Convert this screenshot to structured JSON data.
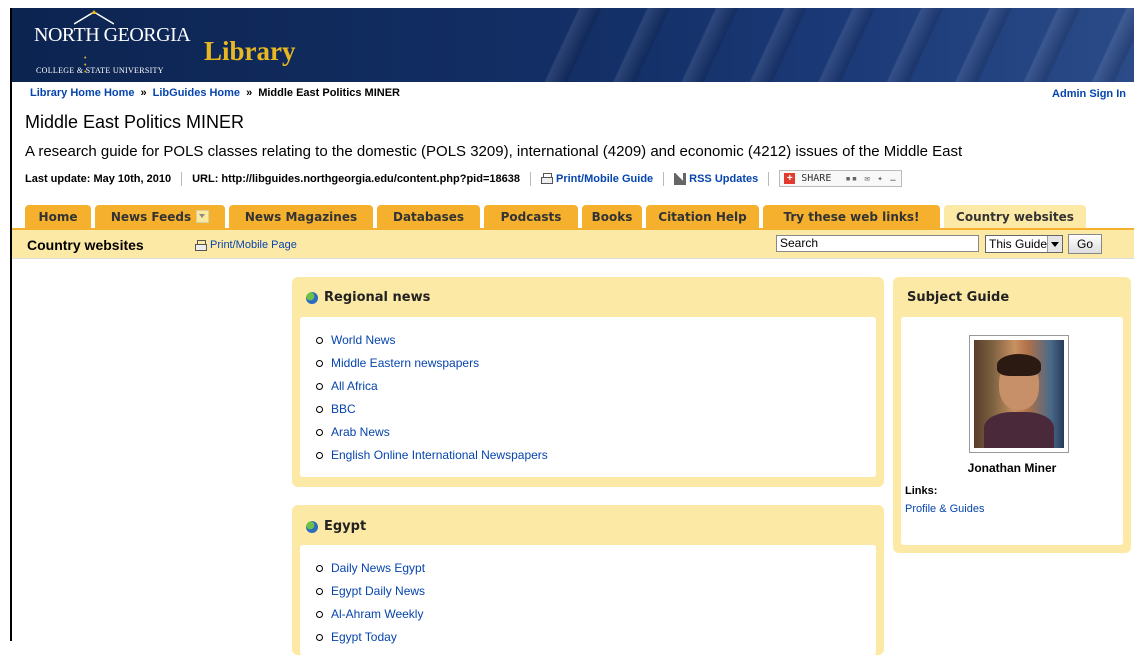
{
  "header": {
    "logo_title": "NORTH GEORGIA",
    "logo_subtitle": "COLLEGE & STATE UNIVERSITY",
    "library_label": "Library"
  },
  "breadcrumb": {
    "items": [
      "Library Home Home",
      "LibGuides Home"
    ],
    "separator": "»",
    "current": "Middle East Politics MINER"
  },
  "admin_link": "Admin Sign In",
  "page": {
    "title": "Middle East Politics MINER",
    "description": "A research guide for POLS classes relating to the domestic (POLS 3209), international (4209) and economic (4212) issues of the Middle East",
    "last_update": "Last update: May 10th, 2010",
    "url": "URL: http://libguides.northgeorgia.edu/content.php?pid=18638",
    "print_guide": "Print/Mobile Guide",
    "rss": "RSS Updates",
    "share": "SHARE"
  },
  "tabs": [
    {
      "label": "Home"
    },
    {
      "label": "News Feeds"
    },
    {
      "label": "News Magazines"
    },
    {
      "label": "Databases"
    },
    {
      "label": "Podcasts"
    },
    {
      "label": "Books"
    },
    {
      "label": "Citation Help"
    },
    {
      "label": "Try these web links!"
    },
    {
      "label": "Country websites"
    }
  ],
  "subbar": {
    "title": "Country websites",
    "print_page": "Print/Mobile Page",
    "search_value": "Search",
    "scope": "This Guide",
    "go": "Go"
  },
  "boxes": {
    "regional": {
      "title": "Regional news",
      "links": [
        "World News",
        "Middle Eastern newspapers",
        "All Africa",
        "BBC",
        "Arab News",
        "English Online International Newspapers"
      ]
    },
    "egypt": {
      "title": "Egypt",
      "links": [
        "Daily News Egypt",
        "Egypt Daily News",
        "Al-Ahram Weekly",
        "Egypt Today"
      ]
    },
    "subject_guide": {
      "title": "Subject Guide",
      "name": "Jonathan Miner",
      "links_label": "Links:",
      "profile_link": "Profile & Guides"
    }
  },
  "colors": {
    "tab": "#f5b02e",
    "tab_active": "#fde9a6",
    "box": "#fde9a6",
    "link": "#0645ad",
    "header": "#0c2450",
    "logo_gold": "#e8b820"
  }
}
